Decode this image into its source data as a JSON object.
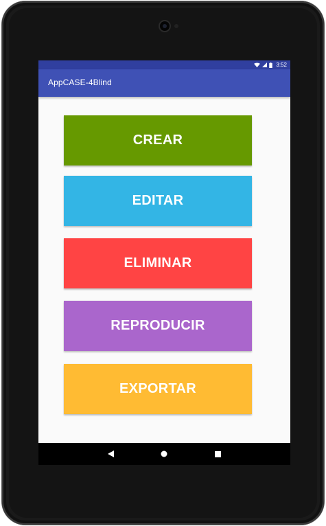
{
  "status_bar": {
    "time": "3:52"
  },
  "app_bar": {
    "title": "AppCASE-4Blind"
  },
  "actions": [
    {
      "label": "CREAR",
      "color": "#669900"
    },
    {
      "label": "EDITAR",
      "color": "#33b5e5"
    },
    {
      "label": "ELIMINAR",
      "color": "#ff4444"
    },
    {
      "label": "REPRODUCIR",
      "color": "#aa66cc"
    },
    {
      "label": "EXPORTAR",
      "color": "#ffbb33"
    }
  ],
  "navigation": {
    "back_icon": "back-triangle",
    "home_icon": "home-circle",
    "recents_icon": "recents-square"
  },
  "colors": {
    "status_bar": "#303f9f",
    "app_bar": "#3f51b5",
    "screen_background": "#fafafa"
  }
}
